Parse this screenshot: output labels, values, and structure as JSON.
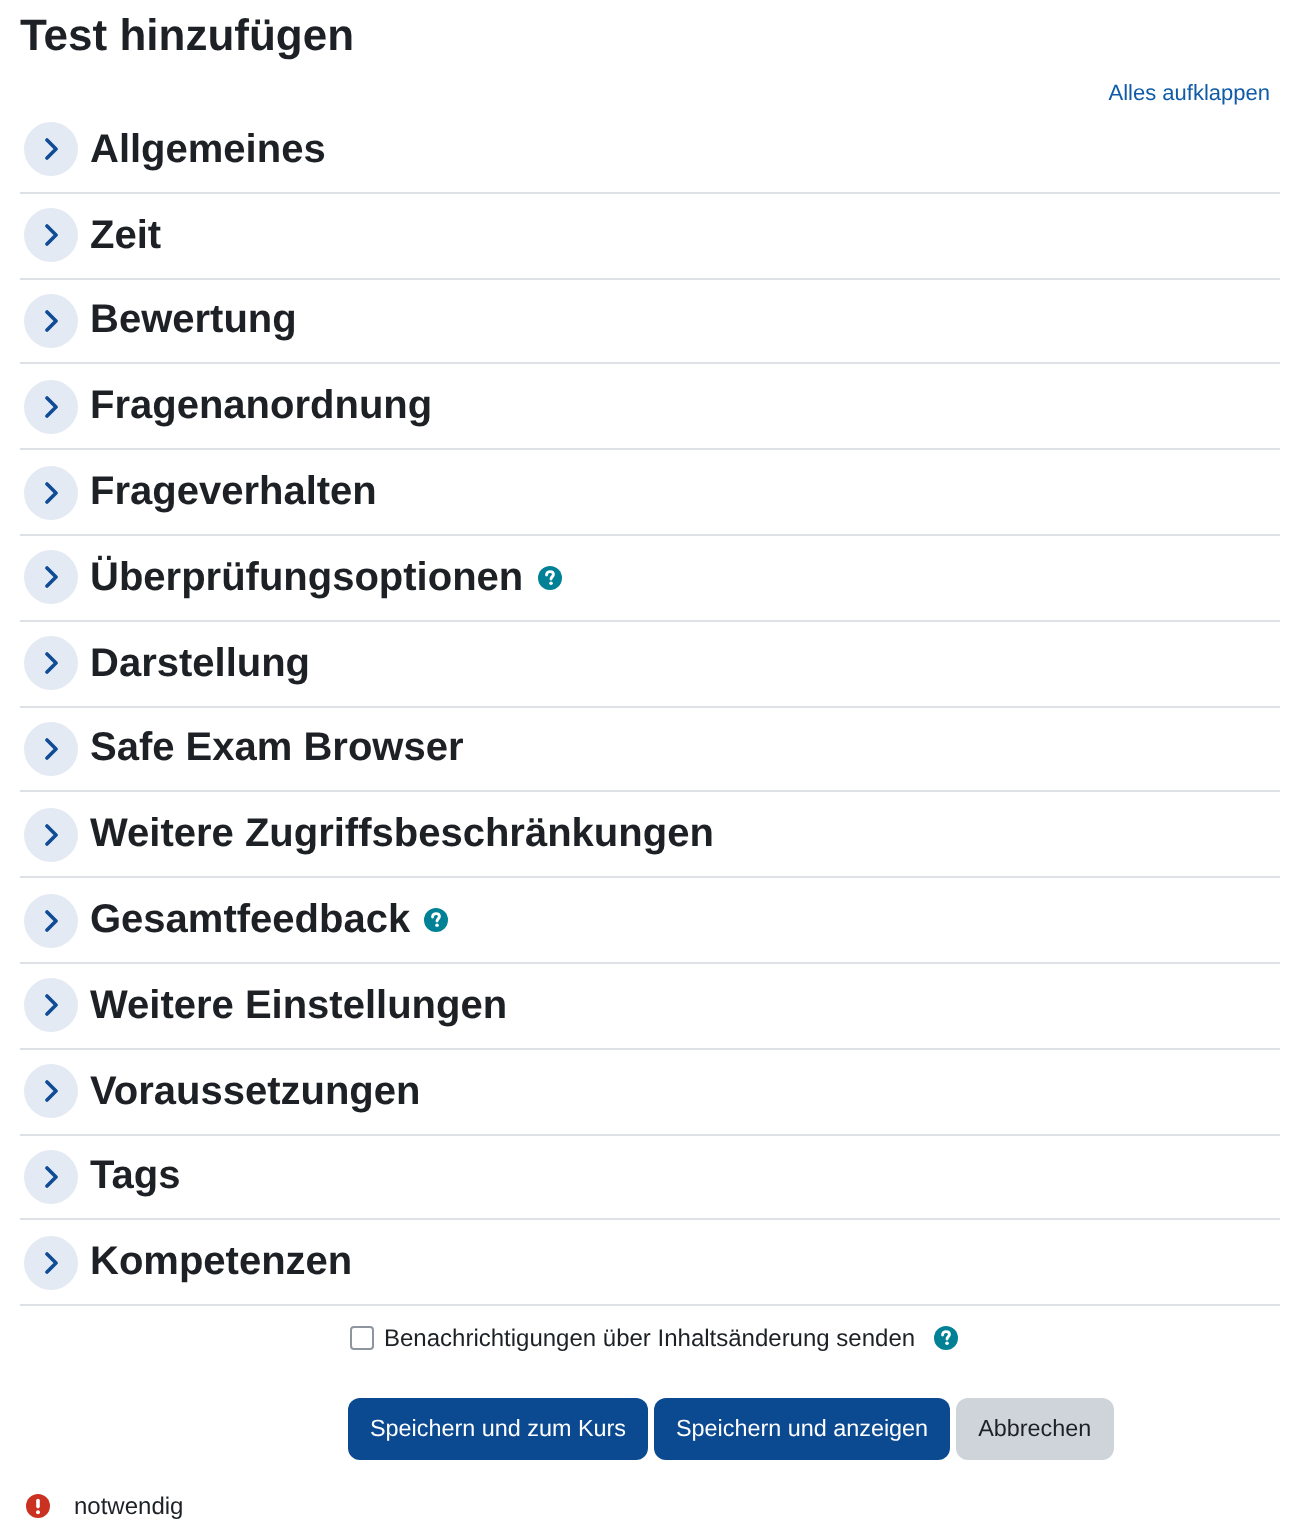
{
  "page": {
    "title": "Test hinzufügen",
    "expand_all_link": "Alles aufklappen"
  },
  "sections": [
    {
      "title": "Allgemeines",
      "expanded": false,
      "help": false
    },
    {
      "title": "Zeit",
      "expanded": false,
      "help": false
    },
    {
      "title": "Bewertung",
      "expanded": false,
      "help": false
    },
    {
      "title": "Fragenanordnung",
      "expanded": false,
      "help": false
    },
    {
      "title": "Frageverhalten",
      "expanded": false,
      "help": false
    },
    {
      "title": "Überprüfungsoptionen",
      "expanded": false,
      "help": true
    },
    {
      "title": "Darstellung",
      "expanded": false,
      "help": false
    },
    {
      "title": "Safe Exam Browser",
      "expanded": false,
      "help": false
    },
    {
      "title": "Weitere Zugriffsbeschränkungen",
      "expanded": false,
      "help": false
    },
    {
      "title": "Gesamtfeedback",
      "expanded": false,
      "help": true
    },
    {
      "title": "Weitere Einstellungen",
      "expanded": false,
      "help": false
    },
    {
      "title": "Voraussetzungen",
      "expanded": false,
      "help": false
    },
    {
      "title": "Tags",
      "expanded": false,
      "help": false
    },
    {
      "title": "Kompetenzen",
      "expanded": false,
      "help": false
    }
  ],
  "notify": {
    "label": "Benachrichtigungen über Inhaltsänderung senden",
    "checked": false,
    "help": true
  },
  "buttons": [
    {
      "label": "Speichern und zum Kurs",
      "kind": "primary"
    },
    {
      "label": "Speichern und anzeigen",
      "kind": "primary"
    },
    {
      "label": "Abbrechen",
      "kind": "secondary"
    }
  ],
  "required_note": {
    "label": "notwendig"
  }
}
